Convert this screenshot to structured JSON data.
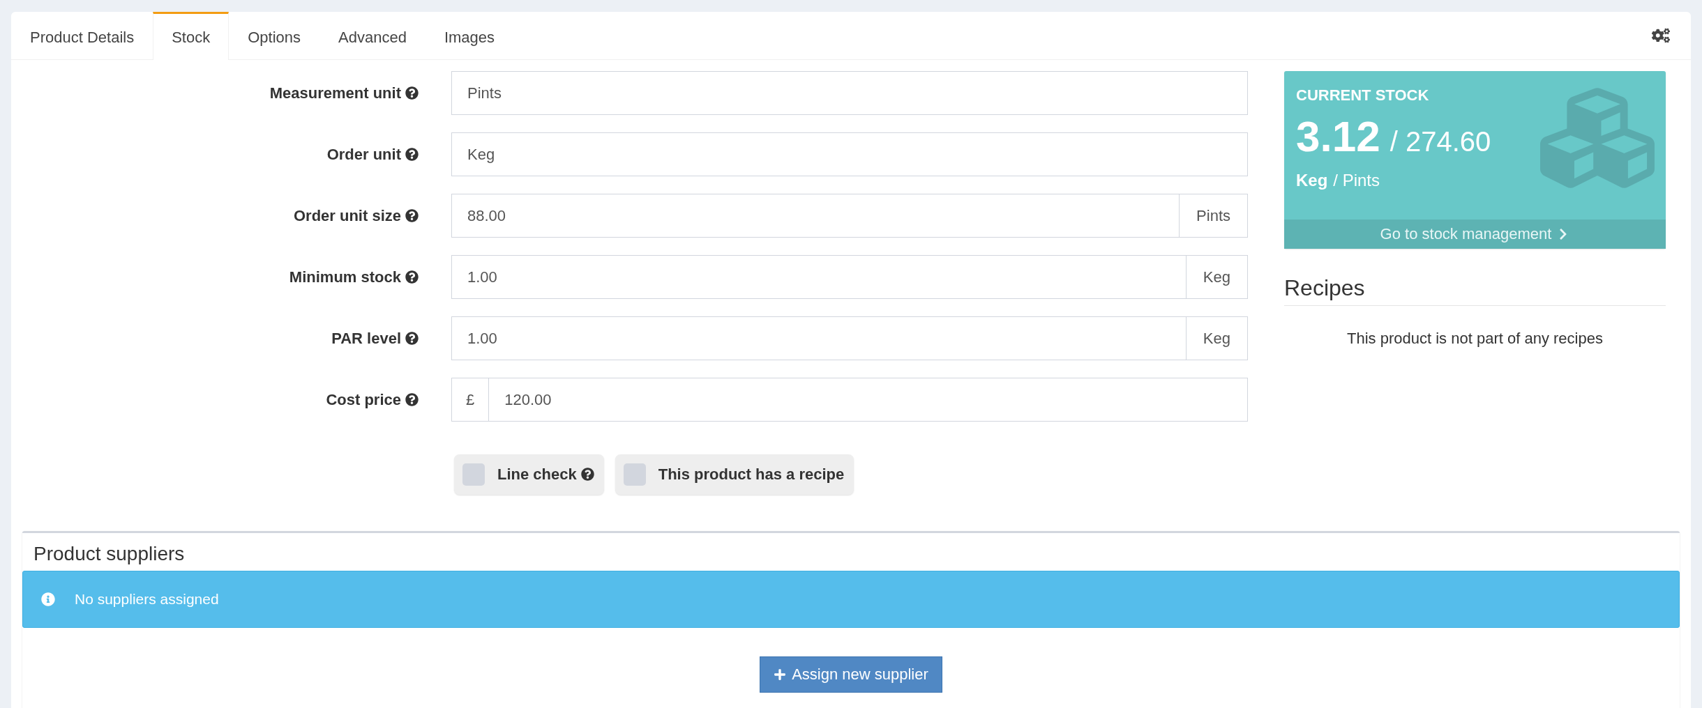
{
  "tabs": [
    {
      "label": "Product Details",
      "selected": false
    },
    {
      "label": "Stock",
      "selected": true
    },
    {
      "label": "Options",
      "selected": false
    },
    {
      "label": "Advanced",
      "selected": false
    },
    {
      "label": "Images",
      "selected": false
    }
  ],
  "fields": [
    {
      "label": "Measurement unit",
      "kind": "plain",
      "value": "Pints"
    },
    {
      "label": "Order unit",
      "kind": "plain",
      "value": "Keg"
    },
    {
      "label": "Order unit size",
      "kind": "suffix",
      "value": "88.00",
      "addon": "Pints"
    },
    {
      "label": "Minimum stock",
      "kind": "suffix",
      "value": "1.00",
      "addon": "Keg"
    },
    {
      "label": "PAR level",
      "kind": "suffix",
      "value": "1.00",
      "addon": "Keg"
    },
    {
      "label": "Cost price",
      "kind": "prefix",
      "value": "120.00",
      "addon": "£"
    }
  ],
  "checkboxes": [
    {
      "label": "Line check",
      "checked": false,
      "help": true
    },
    {
      "label": "This product has a recipe",
      "checked": false,
      "help": false
    }
  ],
  "stock_card": {
    "title": "CURRENT STOCK",
    "current": "3.12",
    "total": "/ 274.60",
    "order_unit": "Keg",
    "measure_unit": "/ Pints",
    "link": "Go to stock management"
  },
  "recipes": {
    "title": "Recipes",
    "empty_text": "This product is not part of any recipes"
  },
  "suppliers": {
    "title": "Product suppliers",
    "alert": "No suppliers assigned",
    "button": "Assign new supplier"
  }
}
